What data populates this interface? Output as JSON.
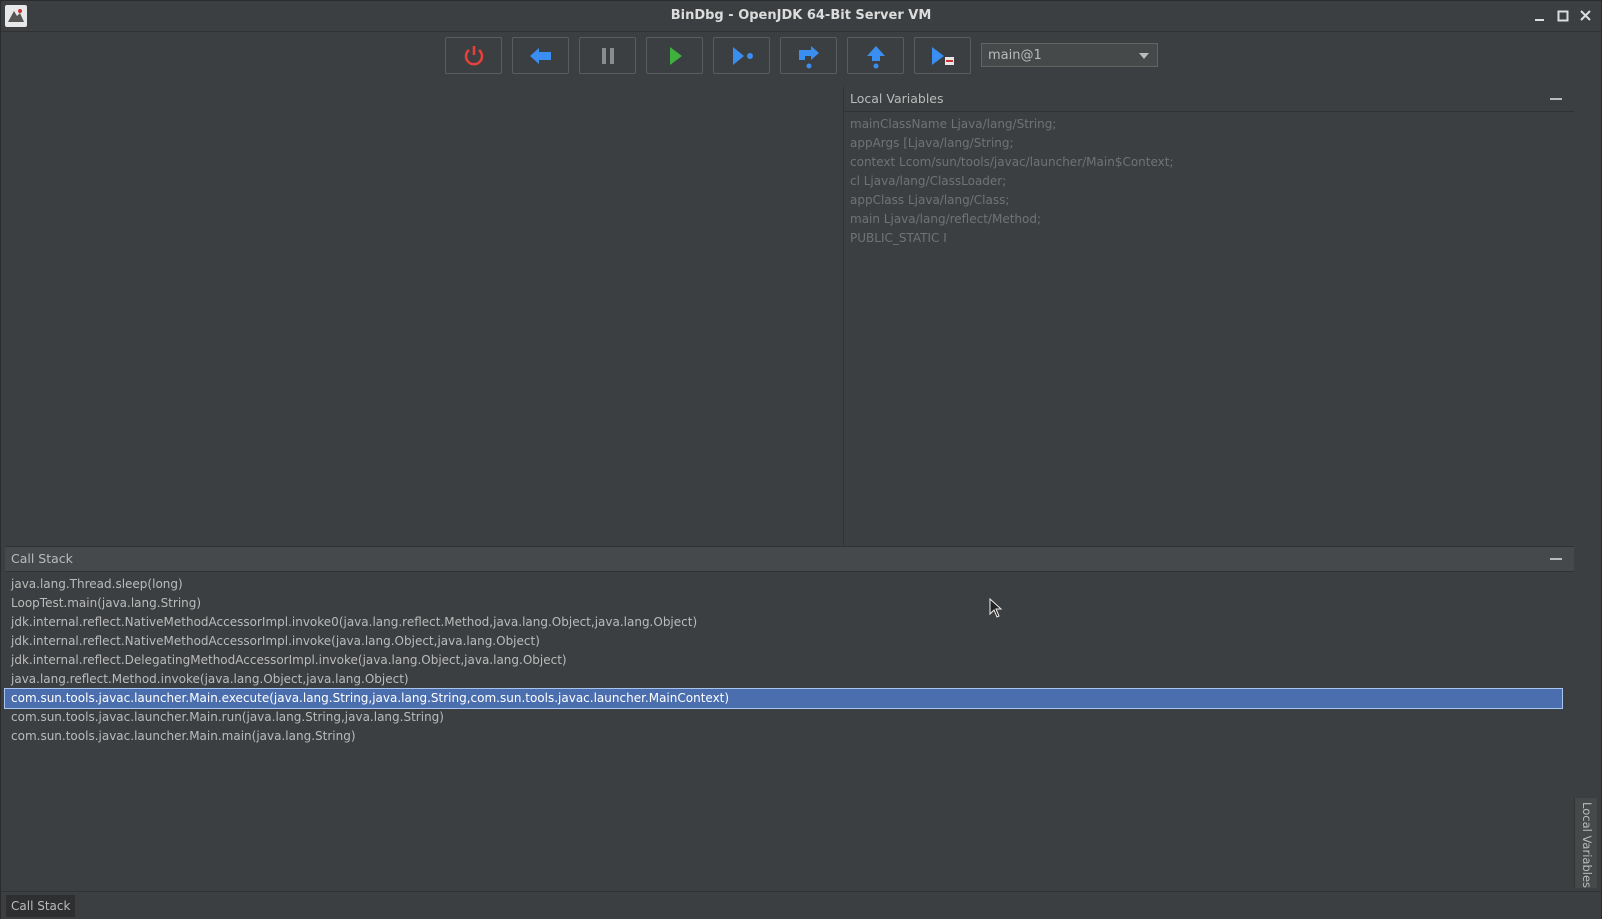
{
  "window": {
    "title": "BinDbg - OpenJDK 64-Bit Server VM"
  },
  "toolbar": {
    "buttons": [
      {
        "name": "stop-button",
        "icon": "power-icon",
        "color": "#e8403a"
      },
      {
        "name": "step-back-button",
        "icon": "arrow-left-icon",
        "color": "#3a8ef0"
      },
      {
        "name": "pause-button",
        "icon": "pause-icon",
        "color": "#8a8d8f"
      },
      {
        "name": "resume-button",
        "icon": "play-icon",
        "color": "#3fb13f"
      },
      {
        "name": "run-to-cursor-button",
        "icon": "run-to-cursor-icon",
        "color": "#3a8ef0"
      },
      {
        "name": "step-over-button",
        "icon": "step-over-icon",
        "color": "#3a8ef0"
      },
      {
        "name": "step-out-button",
        "icon": "step-out-icon",
        "color": "#3a8ef0"
      },
      {
        "name": "step-into-button",
        "icon": "step-into-icon",
        "color": "#3a8ef0"
      }
    ],
    "thread_select": {
      "value": "main@1"
    }
  },
  "locals": {
    "header": "Local Variables",
    "items": [
      "mainClassName Ljava/lang/String;",
      "appArgs [Ljava/lang/String;",
      "context Lcom/sun/tools/javac/launcher/Main$Context;",
      "cl Ljava/lang/ClassLoader;",
      "appClass Ljava/lang/Class;",
      "main Ljava/lang/reflect/Method;",
      "PUBLIC_STATIC I"
    ]
  },
  "callstack": {
    "header": "Call Stack",
    "items": [
      "java.lang.Thread.sleep(long)",
      "LoopTest.main(java.lang.String)",
      "jdk.internal.reflect.NativeMethodAccessorImpl.invoke0(java.lang.reflect.Method,java.lang.Object,java.lang.Object)",
      "jdk.internal.reflect.NativeMethodAccessorImpl.invoke(java.lang.Object,java.lang.Object)",
      "jdk.internal.reflect.DelegatingMethodAccessorImpl.invoke(java.lang.Object,java.lang.Object)",
      "java.lang.reflect.Method.invoke(java.lang.Object,java.lang.Object)",
      "com.sun.tools.javac.launcher.Main.execute(java.lang.String,java.lang.String,com.sun.tools.javac.launcher.MainContext)",
      "com.sun.tools.javac.launcher.Main.run(java.lang.String,java.lang.String)",
      "com.sun.tools.javac.launcher.Main.main(java.lang.String)"
    ],
    "selected_index": 6
  },
  "side_tab": {
    "label": "Local Variables"
  },
  "bottom_tab": {
    "label": "Call Stack"
  }
}
